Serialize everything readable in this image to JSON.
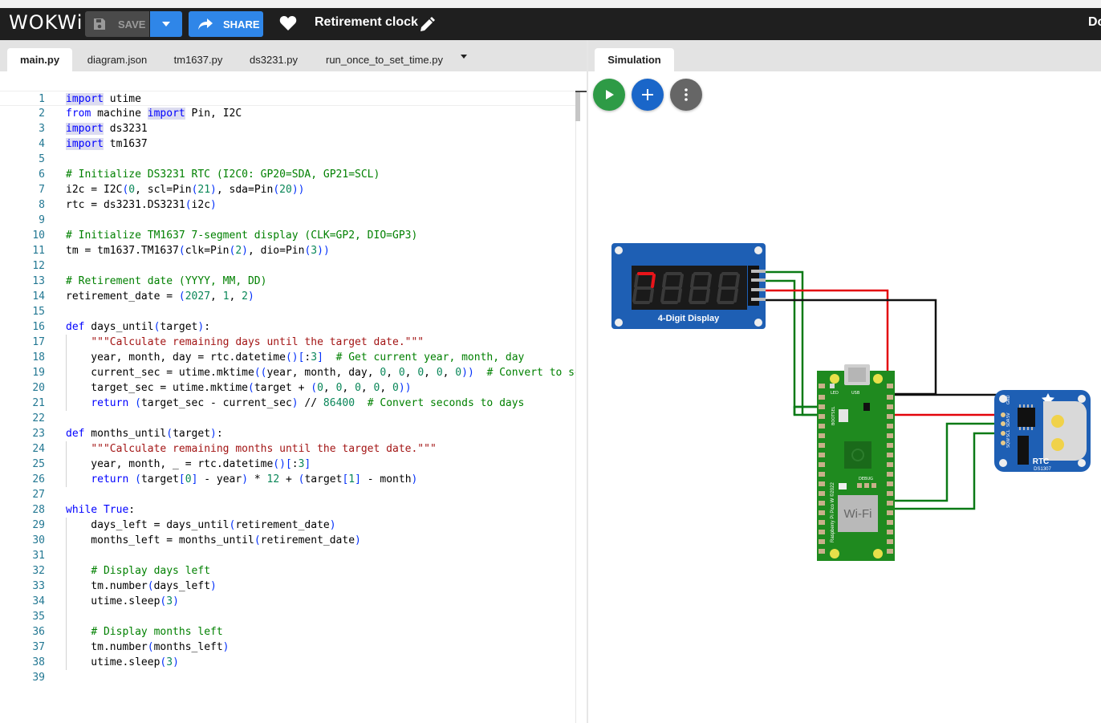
{
  "header": {
    "logo": "WOKWi",
    "save_label": "SAVE",
    "share_label": "SHARE",
    "project_title": "Retirement clock",
    "right_text": "Do"
  },
  "editor": {
    "tabs": [
      {
        "label": "main.py",
        "active": true
      },
      {
        "label": "diagram.json"
      },
      {
        "label": "tm1637.py"
      },
      {
        "label": "ds3231.py"
      },
      {
        "label": "run_once_to_set_time.py"
      }
    ],
    "lines": [
      "import utime",
      "from machine import Pin, I2C",
      "import ds3231",
      "import tm1637",
      "",
      "# Initialize DS3231 RTC (I2C0: GP20=SDA, GP21=SCL)",
      "i2c = I2C(0, scl=Pin(21), sda=Pin(20))",
      "rtc = ds3231.DS3231(i2c)",
      "",
      "# Initialize TM1637 7-segment display (CLK=GP2, DIO=GP3)",
      "tm = tm1637.TM1637(clk=Pin(2), dio=Pin(3))",
      "",
      "# Retirement date (YYYY, MM, DD)",
      "retirement_date = (2027, 1, 2)",
      "",
      "def days_until(target):",
      "    \"\"\"Calculate remaining days until the target date.\"\"\"",
      "    year, month, day = rtc.datetime()[:3]  # Get current year, month, day",
      "    current_sec = utime.mktime((year, month, day, 0, 0, 0, 0, 0))  # Convert to seco",
      "    target_sec = utime.mktime(target + (0, 0, 0, 0, 0))",
      "    return (target_sec - current_sec) // 86400  # Convert seconds to days",
      "",
      "def months_until(target):",
      "    \"\"\"Calculate remaining months until the target date.\"\"\"",
      "    year, month, _ = rtc.datetime()[:3]",
      "    return (target[0] - year) * 12 + (target[1] - month)",
      "",
      "while True:",
      "    days_left = days_until(retirement_date)",
      "    months_left = months_until(retirement_date)",
      "",
      "    # Display days left",
      "    tm.number(days_left)",
      "    utime.sleep(3)",
      "",
      "    # Display months left",
      "    tm.number(months_left)",
      "    utime.sleep(3)",
      ""
    ]
  },
  "simulation": {
    "tab_label": "Simulation",
    "display_label": "4-Digit Display",
    "display_digit": "7",
    "pico_wifi_label": "Wi-Fi",
    "pico_debug_label": "DEBUG",
    "pico_led_label": "LED",
    "pico_usb_label": "USB",
    "pico_bootsel_label": "BOOTSEL",
    "pico_name": "Raspberry Pi Pico W ©2022",
    "rtc_label": "RTC",
    "rtc_model": "DS1307",
    "rtc_pins": [
      "GND",
      "5V",
      "SDA",
      "SCL",
      "SQW"
    ]
  },
  "colors": {
    "header_bg": "#1f1f1f",
    "accent_blue": "#2f86e8",
    "play_green": "#2e9b46",
    "pcb_green": "#1f8a1f",
    "module_blue": "#1e5fb4",
    "segment_on": "#e8141a"
  }
}
